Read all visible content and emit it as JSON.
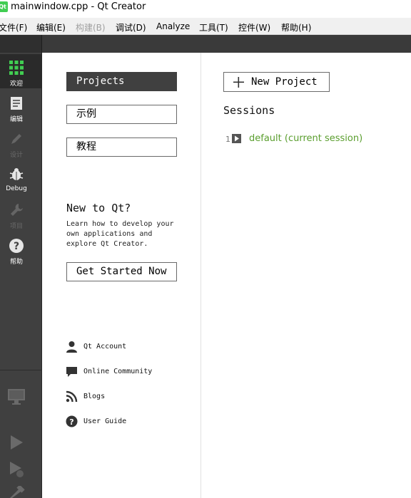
{
  "window": {
    "title": "mainwindow.cpp - Qt Creator",
    "app_icon_text": "Qt"
  },
  "menu": [
    {
      "label": "文件(F)",
      "enabled": true
    },
    {
      "label": "编辑(E)",
      "enabled": true
    },
    {
      "label": "构建(B)",
      "enabled": false
    },
    {
      "label": "调试(D)",
      "enabled": true
    },
    {
      "label": "Analyze",
      "enabled": true
    },
    {
      "label": "工具(T)",
      "enabled": true
    },
    {
      "label": "控件(W)",
      "enabled": true
    },
    {
      "label": "帮助(H)",
      "enabled": true
    }
  ],
  "modes": [
    {
      "label": "欢迎",
      "icon": "grid-icon",
      "active": true,
      "enabled": true
    },
    {
      "label": "编辑",
      "icon": "document-icon",
      "active": false,
      "enabled": true
    },
    {
      "label": "设计",
      "icon": "pencil-icon",
      "active": false,
      "enabled": false
    },
    {
      "label": "Debug",
      "icon": "bug-icon",
      "active": false,
      "enabled": true
    },
    {
      "label": "项目",
      "icon": "wrench-icon",
      "active": false,
      "enabled": false
    },
    {
      "label": "帮助",
      "icon": "help-icon",
      "active": false,
      "enabled": true
    }
  ],
  "bottom_tools": [
    {
      "icon": "monitor-icon"
    },
    {
      "icon": "run-icon"
    },
    {
      "icon": "debug-run-icon"
    },
    {
      "icon": "build-hammer-icon"
    }
  ],
  "welcome": {
    "nav_buttons": [
      {
        "label": "Projects",
        "active": true
      },
      {
        "label": "示例",
        "active": false
      },
      {
        "label": "教程",
        "active": false
      }
    ],
    "new_to_qt": {
      "title": "New to Qt?",
      "description": "Learn how to develop your own applications and explore Qt Creator.",
      "button": "Get Started Now"
    },
    "links": [
      {
        "label": "Qt Account",
        "icon": "user-icon"
      },
      {
        "label": "Online Community",
        "icon": "chat-icon"
      },
      {
        "label": "Blogs",
        "icon": "rss-icon"
      },
      {
        "label": "User Guide",
        "icon": "question-icon"
      }
    ]
  },
  "projects": {
    "new_project_label": "New Project",
    "sessions_title": "Sessions",
    "sessions": [
      {
        "number": "1",
        "name": "default (current session)"
      }
    ]
  },
  "colors": {
    "mode_bar": "#404040",
    "active_mode": "#2a2a2a",
    "qt_green": "#41cd52",
    "session_link": "#5a9e2e"
  }
}
